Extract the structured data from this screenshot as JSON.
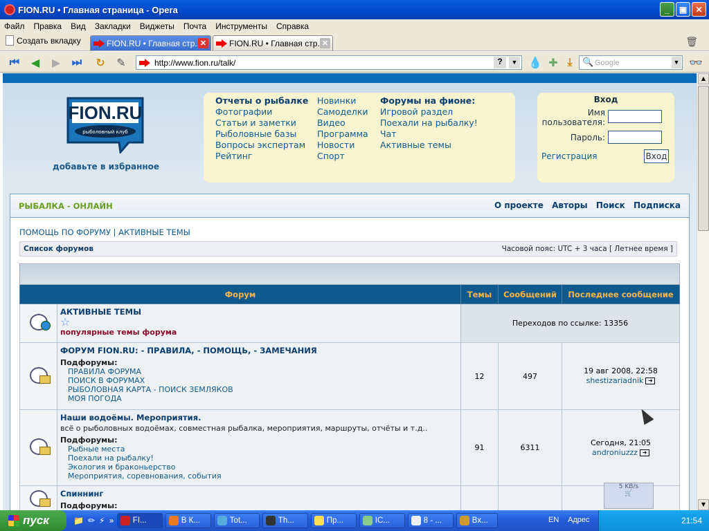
{
  "window": {
    "title": "FION.RU • Главная страница - Opera"
  },
  "menu": [
    "Файл",
    "Правка",
    "Вид",
    "Закладки",
    "Виджеты",
    "Почта",
    "Инструменты",
    "Справка"
  ],
  "tabs": {
    "new_tab": "Создать вкладку",
    "items": [
      {
        "label": "FION.RU • Главная стр...",
        "active": true
      },
      {
        "label": "FION.RU • Главная стр...",
        "active": false
      }
    ]
  },
  "address": {
    "url": "http://www.fion.ru/talk/",
    "help": "?"
  },
  "search": {
    "placeholder": "Google"
  },
  "site": {
    "logo_text": "FION.RU",
    "logo_subtitle": "рыболовный клуб",
    "add_favorites": "добавьте в избранное",
    "links": {
      "col1": [
        "Отчеты о рыбалке",
        "Фотографии",
        "Статьи и заметки",
        "Рыболовные базы",
        "Вопросы экспертам",
        "Рейтинг"
      ],
      "col2": [
        "Новинки",
        "Самоделки",
        "Видео",
        "Программа",
        "Новости",
        "Спорт"
      ],
      "col3": [
        "Форумы на фионе:",
        "Игровой раздел",
        "Поехали на рыбалку!",
        "Чат",
        "Активные темы"
      ]
    },
    "login": {
      "header": "Вход",
      "username_label_1": "Имя",
      "username_label_2": "пользователя:",
      "password_label": "Пароль:",
      "register": "Регистрация",
      "submit": "Вход"
    }
  },
  "board": {
    "title": "РЫБАЛКА - ОНЛАЙН",
    "nav": [
      "О проекте",
      "Авторы",
      "Поиск",
      "Подписка"
    ],
    "help_link": "ПОМОЩЬ ПО ФОРУМУ",
    "sep": "|",
    "active_link": "АКТИВНЫЕ ТЕМЫ",
    "forum_list": "Список форумов",
    "timezone": "Часовой пояс: UTC + 3 часа [ Летнее время ]",
    "columns": [
      "Форум",
      "Темы",
      "Сообщений",
      "Последнее сообщение"
    ],
    "active_row": {
      "title": "АКТИВНЫЕ ТЕМЫ",
      "popular": "популярные темы форума",
      "redirects": "Переходов по ссылке: 13356"
    },
    "forums": [
      {
        "title": "ФОРУМ FION.RU: - ПРАВИЛА, - ПОМОЩЬ, - ЗАМЕЧАНИЯ",
        "desc": "",
        "subforums_label": "Подфорумы:",
        "subforums": [
          "ПРАВИЛА ФОРУМА",
          "ПОИСК В ФОРУМАХ",
          "РЫБОЛОВНАЯ КАРТА - ПОИСК ЗЕМЛЯКОВ",
          "МОЯ ПОГОДА"
        ],
        "topics": "12",
        "posts": "497",
        "last_date": "19 авг 2008, 22:58",
        "last_user": "shestizariadnik"
      },
      {
        "title": "Наши водоёмы. Мероприятия.",
        "desc": "всё о рыболовных водоёмах, совместная рыбалка, мероприятия, маршруты, отчёты и т.д..",
        "subforums_label": "Подфорумы:",
        "subforums": [
          "Рыбные места",
          "Поехали на рыбалку!",
          "Экология и браконьерство",
          "Мероприятия, соревнования, события"
        ],
        "topics": "91",
        "posts": "6311",
        "last_date": "Сегодня, 21:05",
        "last_user": "androniuzzz"
      },
      {
        "title": "Спиннинг",
        "subforums_label": "Подфорумы:"
      }
    ]
  },
  "widget": {
    "speed": "5 KB/s"
  },
  "taskbar": {
    "start": "пуск",
    "buttons": [
      "FI...",
      "В К...",
      "Tot...",
      "Th...",
      "Пр...",
      "IC...",
      "8 - ...",
      "Вх..."
    ],
    "lang": "EN",
    "address": "Адрес",
    "clock": "21:54"
  }
}
